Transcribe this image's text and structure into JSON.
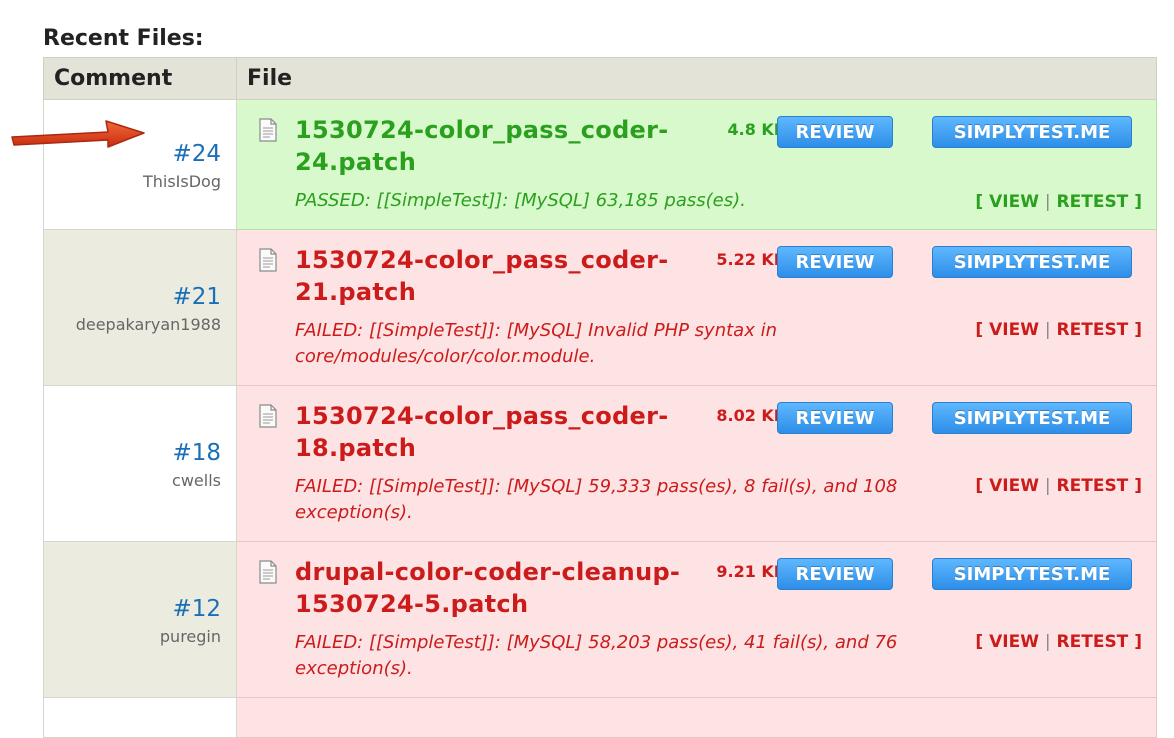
{
  "section_title": "Recent Files:",
  "columns": {
    "comment": "Comment",
    "file": "File"
  },
  "buttons": {
    "review": "REVIEW",
    "simplytest": "SIMPLYTEST.ME"
  },
  "actions": {
    "open": "[",
    "view": "VIEW",
    "sep": "|",
    "retest": "RETEST",
    "close": "]"
  },
  "colors": {
    "passed": "#2ba01e",
    "failed": "#cc1b1b",
    "link": "#1a6fb6"
  },
  "rows": [
    {
      "comment_num": "#24",
      "user": "ThisIsDog",
      "filename_line1": "1530724-color_pass_coder-",
      "filename_line2": "24.patch",
      "size": "4.8 KB",
      "status": "passed",
      "message": "PASSED: [[SimpleTest]]: [MySQL] 63,185 pass(es)."
    },
    {
      "comment_num": "#21",
      "user": "deepakaryan1988",
      "filename_line1": "1530724-color_pass_coder-",
      "filename_line2": "21.patch",
      "size": "5.22 KB",
      "status": "failed",
      "message": "FAILED: [[SimpleTest]]: [MySQL] Invalid PHP syntax in core/modules/color/color.module."
    },
    {
      "comment_num": "#18",
      "user": "cwells",
      "filename_line1": "1530724-color_pass_coder-",
      "filename_line2": "18.patch",
      "size": "8.02 KB",
      "status": "failed",
      "message": "FAILED: [[SimpleTest]]: [MySQL] 59,333 pass(es), 8 fail(s), and 108 exception(s)."
    },
    {
      "comment_num": "#12",
      "user": "puregin",
      "filename_line1": "drupal-color-coder-cleanup-",
      "filename_line2": "1530724-5.patch",
      "size": "9.21 KB",
      "status": "failed",
      "message": "FAILED: [[SimpleTest]]: [MySQL] 58,203 pass(es), 41 fail(s), and 76 exception(s)."
    }
  ]
}
